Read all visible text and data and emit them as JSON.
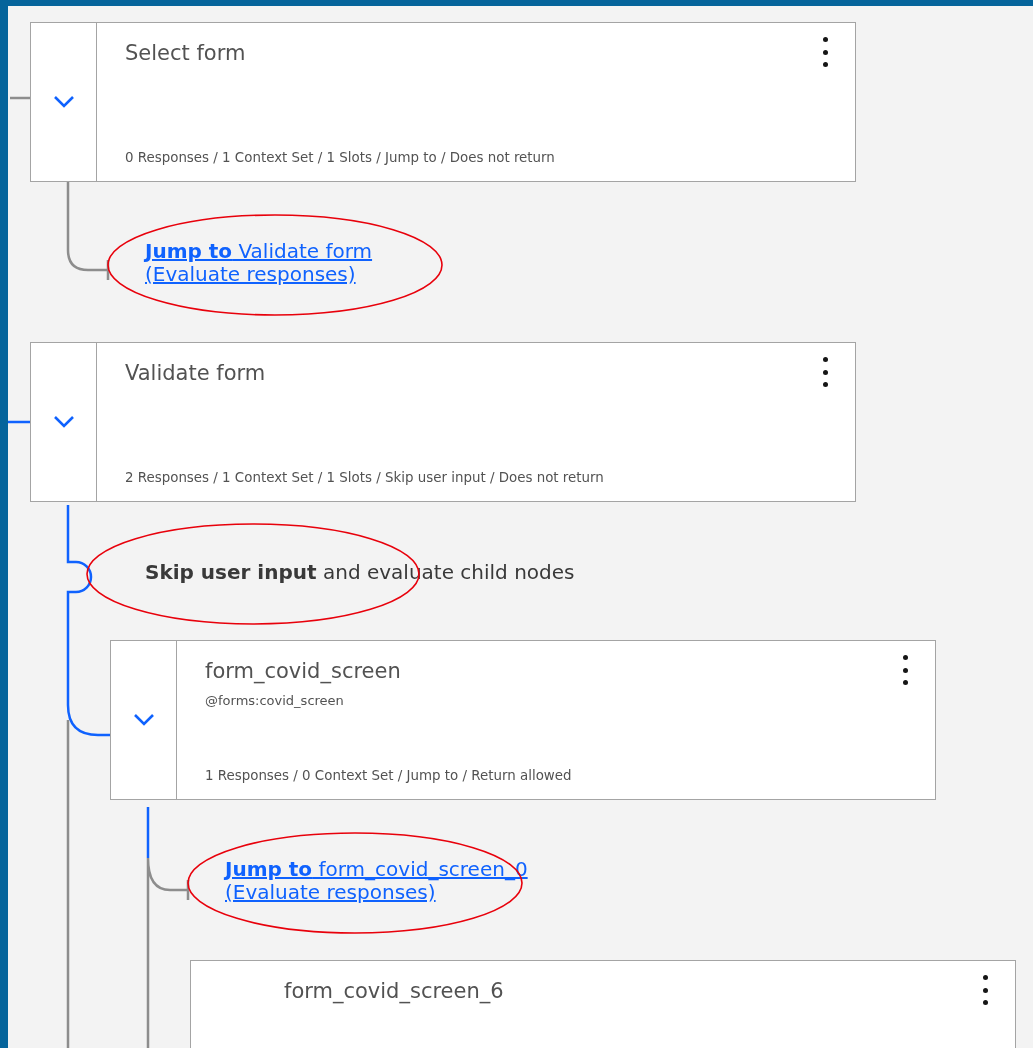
{
  "nodes": [
    {
      "title": "Select form",
      "meta": "0 Responses / 1 Context Set / 1 Slots / Jump to / Does not return",
      "expanded": true,
      "jump": {
        "text": "**Jump to** Validate form",
        "subtext": "(Evaluate responses)",
        "circled": true
      }
    },
    {
      "title": "Validate form",
      "meta": "2 Responses / 1 Context Set / 1 Slots / Skip user input / Does not return",
      "expanded": true,
      "note": {
        "text": "**Skip user input** and evaluate child nodes",
        "circled": true
      },
      "children": [
        {
          "title": "form_covid_screen",
          "condition": "@forms:covid_screen",
          "meta": "1 Responses / 0 Context Set / Jump to / Return allowed",
          "expanded": true,
          "jump": {
            "text": "**Jump to** form_covid_screen_0",
            "subtext": "(Evaluate responses)",
            "circled": true
          },
          "children": [
            {
              "title": "form_covid_screen_6"
            }
          ]
        }
      ]
    }
  ]
}
